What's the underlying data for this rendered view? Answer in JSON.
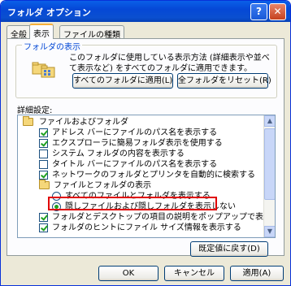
{
  "window": {
    "title": "フォルダ オプション",
    "help_btn": "?",
    "close_btn": "✕"
  },
  "tabs": [
    "全般",
    "表示",
    "ファイルの種類"
  ],
  "folder_views": {
    "group_label": "フォルダの表示",
    "description": "このフォルダに使用している表示方法 (詳細表示や並べて表示など) をすべてのフォルダに適用できます。",
    "apply_all_button": "すべてのフォルダに適用(L)",
    "reset_all_button": "全フォルダをリセット(R)"
  },
  "advanced": {
    "label": "詳細設定:",
    "items": [
      {
        "type": "folder",
        "label": "ファイルおよびフォルダ"
      },
      {
        "type": "checkbox",
        "checked": true,
        "label": "アドレス バーにファイルのパス名を表示する"
      },
      {
        "type": "checkbox",
        "checked": true,
        "label": "エクスプローラに簡易フォルダ表示を使用する"
      },
      {
        "type": "checkbox",
        "checked": false,
        "label": "システム フォルダの内容を表示する"
      },
      {
        "type": "checkbox",
        "checked": false,
        "label": "タイトル バーにファイルのパス名を表示する"
      },
      {
        "type": "checkbox",
        "checked": true,
        "label": "ネットワークのフォルダとプリンタを自動的に検索する"
      },
      {
        "type": "folder",
        "label": "ファイルとフォルダの表示"
      },
      {
        "type": "radio",
        "checked": false,
        "label": "すべてのファイルとフォルダを表示する"
      },
      {
        "type": "radio",
        "checked": true,
        "label": "隠しファイルおよび隠しフォルダを表示しない"
      },
      {
        "type": "checkbox",
        "checked": true,
        "label": "フォルダとデスクトップの項目の説明をポップアップで表示する"
      },
      {
        "type": "checkbox",
        "checked": true,
        "label": "フォルダのヒントにファイル サイズ情報を表示する"
      }
    ]
  },
  "restore_defaults_button": "既定値に戻す(D)",
  "footer": {
    "ok": "OK",
    "cancel": "キャンセル",
    "apply": "適用(A)"
  },
  "colors": {
    "titlebar": "#0548d6",
    "highlight": "#e00000",
    "group_label": "#0046d5"
  }
}
